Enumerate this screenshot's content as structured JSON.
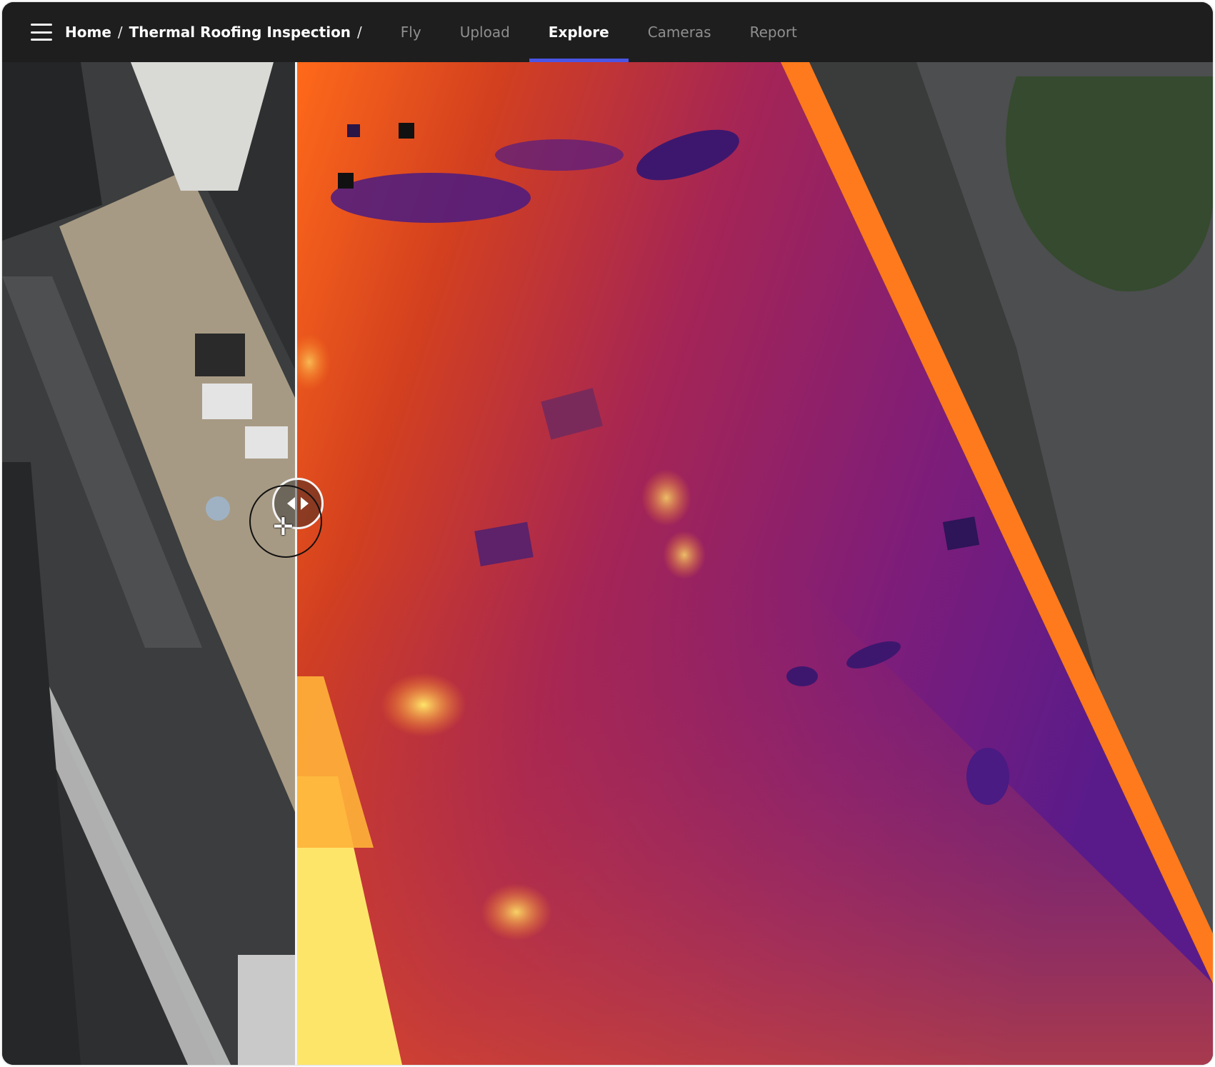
{
  "app": {
    "breadcrumb": {
      "home": "Home",
      "separator": "/",
      "project": "Thermal Roofing Inspection"
    },
    "tabs": [
      {
        "label": "Fly",
        "active": false
      },
      {
        "label": "Upload",
        "active": false
      },
      {
        "label": "Explore",
        "active": true
      },
      {
        "label": "Cameras",
        "active": false
      },
      {
        "label": "Report",
        "active": false
      }
    ]
  },
  "colors": {
    "topbar_bg": "#1e1e1e",
    "active_tab_underline": "#4a55e6",
    "inactive_tab_text": "#8f8f8f",
    "thermal_cold": "#5a1b8a",
    "thermal_warm": "#e0421f",
    "thermal_hot": "#fde56a"
  },
  "icons": {
    "menu": "hamburger-icon",
    "compare_handle": "left-right-arrows-icon",
    "cursor": "move-cursor-icon"
  },
  "compare": {
    "left_layer": "visual",
    "right_layer": "thermal"
  }
}
